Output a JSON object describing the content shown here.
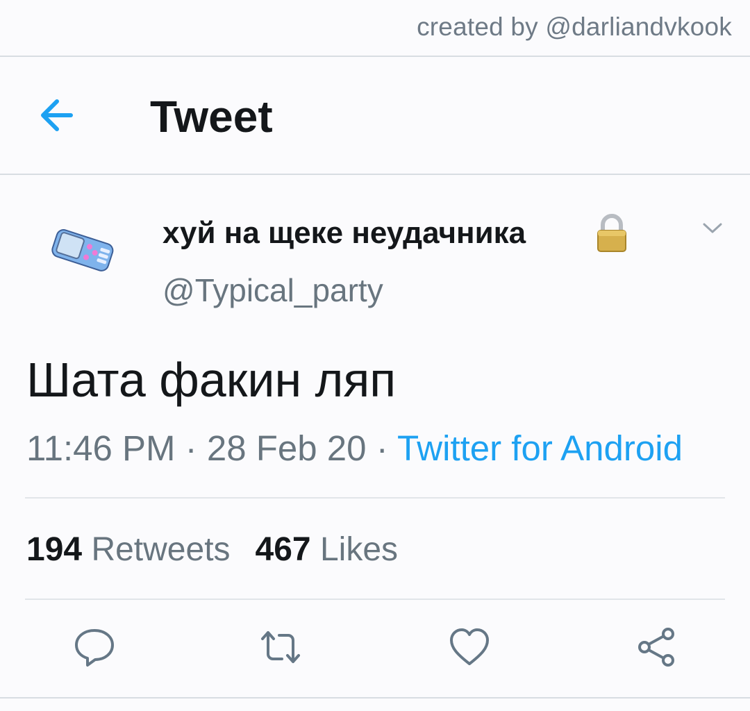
{
  "watermark": "created by @darliandvkook",
  "header": {
    "title": "Tweet"
  },
  "tweet": {
    "display_name": "хуй на щеке неудачника",
    "handle": "@Typical_party",
    "text": "Шата факин ляп",
    "time": "11:46 PM",
    "separator": " · ",
    "date": "28 Feb 20",
    "source": "Twitter for Android",
    "stats": {
      "retweets_count": "194",
      "retweets_label": "Retweets",
      "likes_count": "467",
      "likes_label": "Likes"
    }
  },
  "colors": {
    "accent": "#1da1f2",
    "secondary_text": "#68757f",
    "primary_text": "#14171a",
    "background": "#fbfbfd"
  },
  "icons": {
    "back": "arrow-left-icon",
    "lock": "lock-icon",
    "more": "chevron-down-icon",
    "reply": "reply-icon",
    "retweet": "retweet-icon",
    "like": "heart-icon",
    "share": "share-icon"
  }
}
